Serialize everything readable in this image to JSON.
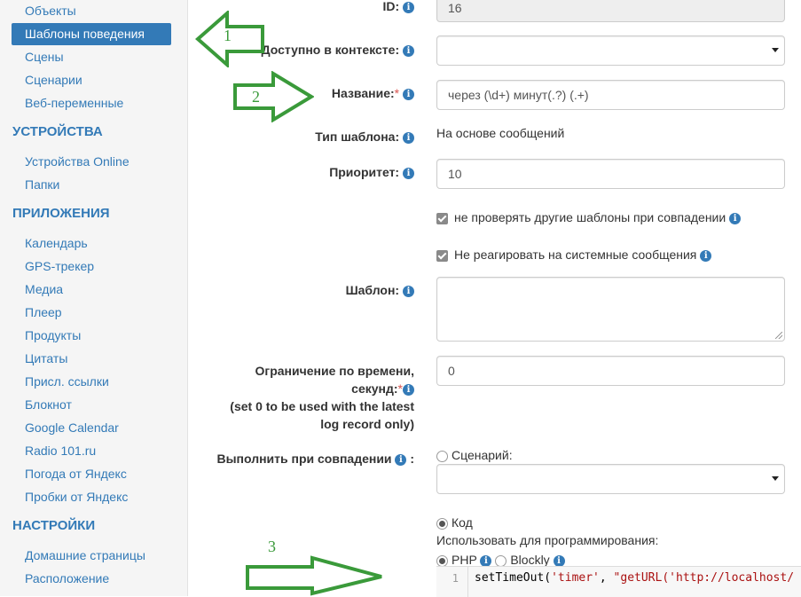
{
  "sidebar": {
    "top_items": [
      "Объекты",
      "Шаблоны поведения",
      "Сцены",
      "Сценарии",
      "Веб-переменные"
    ],
    "devices_header": "УСТРОЙСТВА",
    "devices_items": [
      "Устройства Online",
      "Папки"
    ],
    "apps_header": "ПРИЛОЖЕНИЯ",
    "apps_items": [
      "Календарь",
      "GPS-трекер",
      "Медиа",
      "Плеер",
      "Продукты",
      "Цитаты",
      "Присл. ссылки",
      "Блокнот",
      "Google Calendar",
      "Radio 101.ru",
      "Погода от Яндекс",
      "Пробки от Яндекс"
    ],
    "settings_header": "НАСТРОЙКИ",
    "settings_items": [
      "Домашние страницы",
      "Расположение"
    ]
  },
  "form": {
    "id_label": "ID:",
    "id_value": "16",
    "context_label": "Доступно в контексте:",
    "context_value": "",
    "name_label": "Название:",
    "name_required": "*",
    "name_value": "через (\\d+) минут(.?) (.+)",
    "type_label": "Тип шаблона:",
    "type_value": "На основе сообщений",
    "priority_label": "Приоритет:",
    "priority_value": "10",
    "check1_label": "не проверять другие шаблоны при совпадении",
    "check2_label": "Не реагировать на системные сообщения",
    "pattern_label": "Шаблон:",
    "pattern_value": "",
    "timeout_label_line1": "Ограничение по времени,",
    "timeout_label_line2": "секунд:",
    "timeout_required": "*",
    "timeout_hint_line1": "(set 0 to be used with the latest",
    "timeout_hint_line2": "log record only)",
    "timeout_value": "0",
    "execute_label": "Выполнить при совпадении",
    "execute_colon": ":",
    "scenario_option": "Сценарий:",
    "scenario_value": "",
    "code_option": "Код",
    "use_for_programming": "Использовать для программирования:",
    "php_option": "PHP",
    "blockly_option": "Blockly",
    "code_line_number": "1",
    "code_line_a": "setTimeOut(",
    "code_line_b": "'timer'",
    "code_line_c": ", ",
    "code_line_d": "\"getURL('http://localhost/"
  },
  "annotations": [
    "1",
    "2",
    "3"
  ],
  "colors": {
    "accent": "#337ab7",
    "annotation": "#3a9a3a"
  },
  "icons": {
    "info": "info-icon",
    "caret": "caret-down-icon"
  }
}
